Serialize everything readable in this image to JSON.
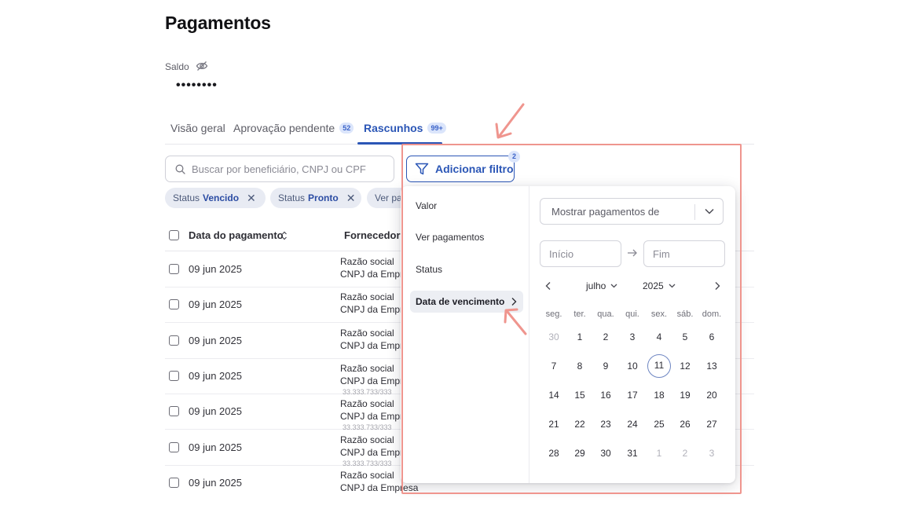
{
  "page": {
    "title": "Pagamentos"
  },
  "balance": {
    "label": "Saldo",
    "value": "••••••••"
  },
  "tabs": [
    {
      "label": "Visão geral",
      "badge": ""
    },
    {
      "label": "Aprovação pendente",
      "badge": "52"
    },
    {
      "label": "Rascunhos",
      "badge": "99+"
    }
  ],
  "search": {
    "placeholder": "Buscar por beneficiário, CNPJ ou CPF"
  },
  "chips": [
    {
      "prefix": "Status",
      "value": "Vencido"
    },
    {
      "prefix": "Status",
      "value": "Pronto"
    },
    {
      "prefix": "Ver pa",
      "value": ""
    }
  ],
  "filter_button": {
    "label": "Adicionar filtro",
    "count": "2"
  },
  "table": {
    "headers": {
      "date": "Data do pagamento",
      "supplier": "Fornecedor"
    },
    "rows": [
      {
        "date": "09 jun 2025",
        "line1": "Razão social",
        "line2": "CNPJ da Empr",
        "cut": ""
      },
      {
        "date": "09 jun 2025",
        "line1": "Razão social",
        "line2": "CNPJ da Empr",
        "cut": ""
      },
      {
        "date": "09 jun 2025",
        "line1": "Razão social",
        "line2": "CNPJ da Empr",
        "cut": ""
      },
      {
        "date": "09 jun 2025",
        "line1": "Razão social",
        "line2": "CNPJ da Empr",
        "cut": "33.333.733/333"
      },
      {
        "date": "09 jun 2025",
        "line1": "Razão social",
        "line2": "CNPJ da Empr",
        "cut": "33.333.733/333"
      },
      {
        "date": "09 jun 2025",
        "line1": "Razão social",
        "line2": "CNPJ da Empr",
        "cut": "33.333.733/333"
      },
      {
        "date": "09 jun 2025",
        "line1": "Razão social",
        "line2": "CNPJ da Empresa",
        "cut": ""
      }
    ]
  },
  "filter_menu": {
    "items": [
      "Valor",
      "Ver pagamentos",
      "Status",
      "Data de vencimento"
    ],
    "active_index": 3
  },
  "date_panel": {
    "show_select": "Mostrar pagamentos de",
    "start_placeholder": "Início",
    "end_placeholder": "Fim",
    "month": "julho",
    "year": "2025",
    "weekdays": [
      "seg.",
      "ter.",
      "qua.",
      "qui.",
      "sex.",
      "sáb.",
      "dom."
    ],
    "weeks": [
      [
        "30",
        "1",
        "2",
        "3",
        "4",
        "5",
        "6"
      ],
      [
        "7",
        "8",
        "9",
        "10",
        "11",
        "12",
        "13"
      ],
      [
        "14",
        "15",
        "16",
        "17",
        "18",
        "19",
        "20"
      ],
      [
        "21",
        "22",
        "23",
        "24",
        "25",
        "26",
        "27"
      ],
      [
        "28",
        "29",
        "30",
        "31",
        "1",
        "2",
        "3"
      ]
    ],
    "muted_days": [
      [
        0,
        0
      ],
      [
        4,
        4
      ],
      [
        4,
        5
      ],
      [
        4,
        6
      ]
    ],
    "today": [
      1,
      4
    ]
  },
  "colors": {
    "accent": "#2b56b6",
    "annotation": "#ef958e",
    "chip_bg": "#e8ebf3"
  }
}
